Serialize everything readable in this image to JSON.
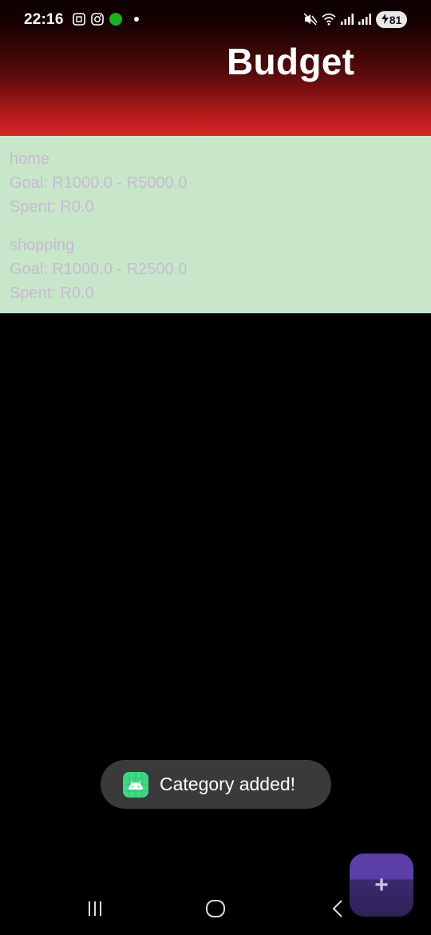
{
  "status_bar": {
    "time": "22:16",
    "battery": "81",
    "icons": [
      "screenshot-icon",
      "instagram-icon",
      "green-dot-icon",
      "notification-dot-icon",
      "mute-icon",
      "wifi-icon",
      "signal-icon",
      "signal-icon-2",
      "battery-charging-icon"
    ]
  },
  "header": {
    "title": "Budget"
  },
  "categories": [
    {
      "name": "home",
      "goal": "Goal: R1000.0 - R5000.0",
      "spent": "Spent: R0.0"
    },
    {
      "name": "shopping",
      "goal": "Goal: R1000.0 - R2500.0",
      "spent": "Spent: R0.0"
    }
  ],
  "toast": {
    "message": "Category added!",
    "icon": "android-icon"
  },
  "fab": {
    "label": "+",
    "icon": "plus-icon"
  },
  "nav": {
    "recents_icon": "recents-icon",
    "home_icon": "home-icon",
    "back_icon": "back-icon"
  },
  "colors": {
    "header_top": "#0b0000",
    "header_bottom": "#d82525",
    "list_background": "#c8e6c9",
    "list_text": "#c5bcd2",
    "toast_background": "#3a3a3a",
    "fab_color": "#3b2a6d"
  }
}
